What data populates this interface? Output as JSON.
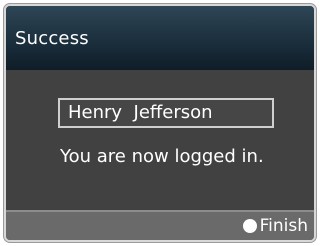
{
  "dialog": {
    "title": "Success",
    "username": "Henry  Jefferson",
    "message": "You are now logged in."
  },
  "footer": {
    "finish_label": "Finish",
    "finish_icon": "filled-circle-icon"
  }
}
